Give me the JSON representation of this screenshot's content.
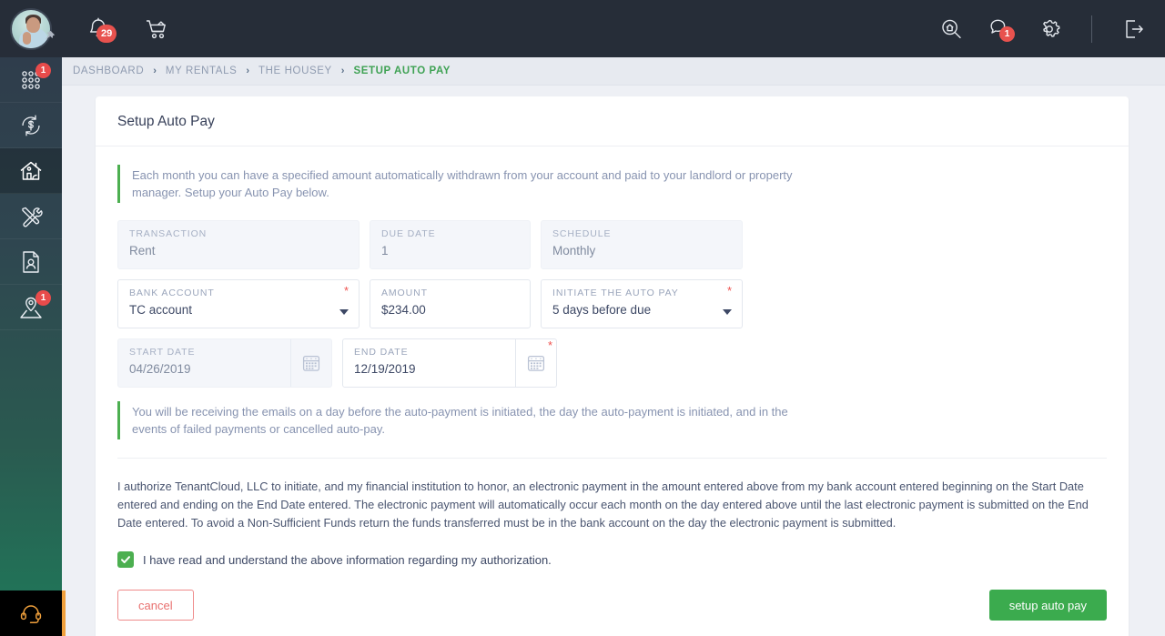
{
  "sidebar": {
    "avatar": {
      "icon": "user-avatar",
      "pin_icon": "pin-icon"
    },
    "items": [
      {
        "icon": "apps-grid-icon",
        "name": "dashboard",
        "badge": "1",
        "active": false
      },
      {
        "icon": "payments-icon",
        "name": "payments",
        "badge": "",
        "active": false
      },
      {
        "icon": "home-icon",
        "name": "rentals",
        "badge": "",
        "active": true
      },
      {
        "icon": "tools-icon",
        "name": "maintenance",
        "badge": "",
        "active": false
      },
      {
        "icon": "document-person-icon",
        "name": "documents",
        "badge": "",
        "active": false
      },
      {
        "icon": "map-pin-person-icon",
        "name": "listings",
        "badge": "1",
        "active": false
      }
    ],
    "support": {
      "icon": "headset-icon",
      "name": "support"
    }
  },
  "topbar": {
    "left_icons": [
      {
        "icon": "bell-icon",
        "name": "notifications",
        "badge": "29"
      },
      {
        "icon": "cart-icon",
        "name": "cart",
        "badge": ""
      }
    ],
    "right_icons": [
      {
        "icon": "home-search-icon",
        "name": "property-search",
        "badge": ""
      },
      {
        "icon": "chat-icon",
        "name": "messages",
        "badge": "1"
      },
      {
        "icon": "gear-icon",
        "name": "settings",
        "badge": ""
      },
      {
        "icon": "logout-icon",
        "name": "logout",
        "badge": ""
      }
    ]
  },
  "breadcrumbs": [
    {
      "label": "DASHBOARD",
      "active": false
    },
    {
      "label": "MY RENTALS",
      "active": false
    },
    {
      "label": "THE HOUSEY",
      "active": false
    },
    {
      "label": "SETUP AUTO PAY",
      "active": true
    }
  ],
  "breadcrumb_separator": "›",
  "card": {
    "title": "Setup Auto Pay",
    "note_top": "Each month you can have a specified amount automatically withdrawn from your account and paid to your landlord or property manager. Setup your Auto Pay below.",
    "note_bottom": "You will be receiving the emails on a day before the auto-payment is initiated, the day the auto-payment is initiated, and in the events of failed payments or cancelled auto-pay.",
    "fields": {
      "transaction": {
        "label": "TRANSACTION",
        "value": "Rent"
      },
      "due_date": {
        "label": "DUE DATE",
        "value": "1"
      },
      "schedule": {
        "label": "SCHEDULE",
        "value": "Monthly"
      },
      "bank_account": {
        "label": "BANK ACCOUNT",
        "value": "TC account",
        "required": "*"
      },
      "amount": {
        "label": "AMOUNT",
        "value": "$234.00"
      },
      "initiate": {
        "label": "INITIATE THE AUTO PAY",
        "value": "5 days before due",
        "required": "*"
      },
      "start_date": {
        "label": "START DATE",
        "value": "04/26/2019"
      },
      "end_date": {
        "label": "END DATE",
        "value": "12/19/2019",
        "required": "*"
      }
    },
    "authorization_text": "I authorize TenantCloud, LLC to initiate, and my financial institution to honor, an electronic payment in the amount entered above from my bank account entered beginning on the Start Date entered and ending on the End Date entered. The electronic payment will automatically occur each month on the day entered above until the last electronic payment is submitted on the End Date entered. To avoid a Non-Sufficient Funds return the funds transferred must be in the bank account on the day the electronic payment is submitted.",
    "consent_label": "I have read and understand the above information regarding my authorization.",
    "consent_checked": true,
    "cancel_label": "cancel",
    "submit_label": "setup auto pay"
  },
  "colors": {
    "accent_green": "#3bab4e",
    "note_bar": "#4caf50",
    "required_red": "#ef5350",
    "cancel_red": "#e8706f",
    "badge_red": "#e8524e",
    "topbar_dark": "#262d38",
    "page_bg": "#eef0f5",
    "support_orange": "#f0a03c"
  }
}
